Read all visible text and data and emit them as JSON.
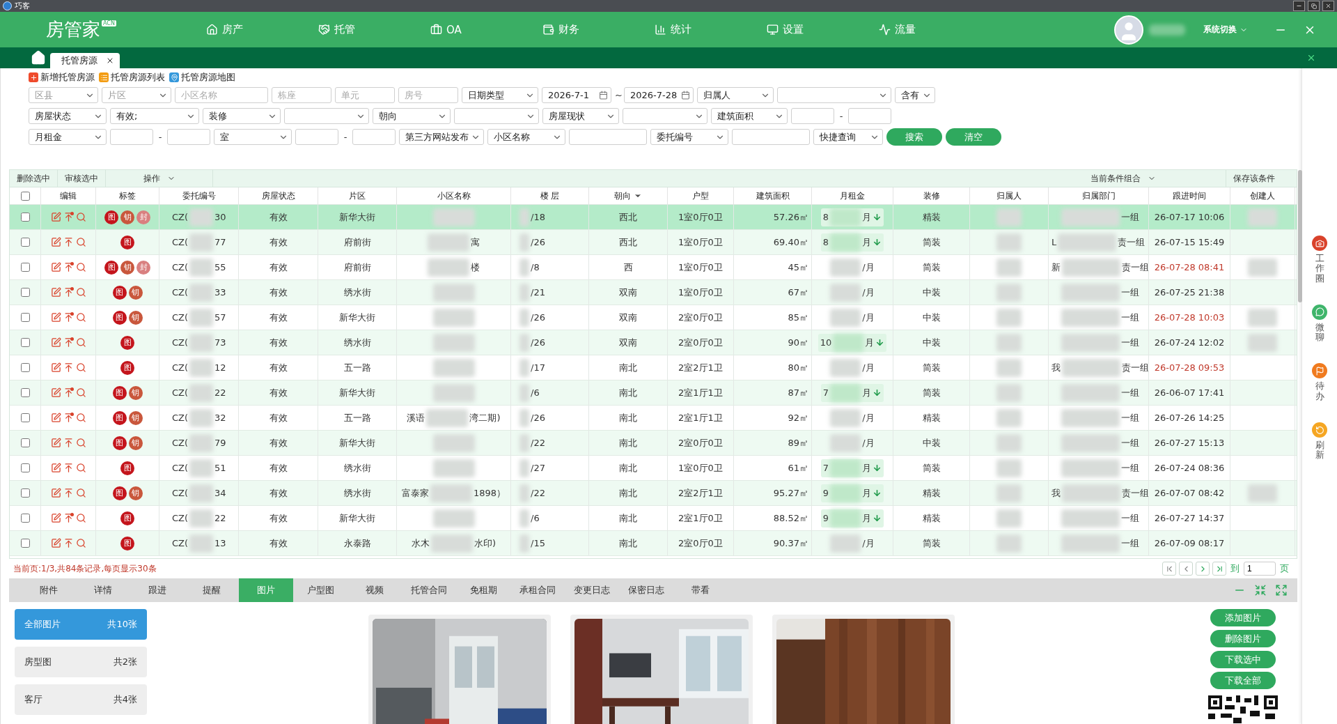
{
  "app": {
    "title": "巧客"
  },
  "header": {
    "logo": "房管家",
    "logo_badge": "ACN",
    "nav": [
      {
        "label": "房产"
      },
      {
        "label": "托管"
      },
      {
        "label": "OA"
      },
      {
        "label": "财务"
      },
      {
        "label": "统计"
      },
      {
        "label": "设置"
      },
      {
        "label": "流量"
      }
    ],
    "system_switch": "系统切换"
  },
  "tabs": [
    {
      "label": "托管房源",
      "selected": true
    }
  ],
  "links": [
    {
      "label": "新增托管房源"
    },
    {
      "label": "托管房源列表"
    },
    {
      "label": "托管房源地图"
    }
  ],
  "filters": [
    [
      {
        "kind": "select",
        "placeholder": "区县"
      },
      {
        "kind": "select",
        "placeholder": "片区"
      },
      {
        "kind": "input",
        "placeholder": "小区名称"
      },
      {
        "kind": "input",
        "placeholder": "栋座"
      },
      {
        "kind": "input",
        "placeholder": "单元"
      },
      {
        "kind": "input",
        "placeholder": "房号"
      },
      {
        "kind": "select",
        "value": "日期类型"
      },
      {
        "kind": "date",
        "value": "2026-7-1"
      },
      {
        "kind": "sep",
        "text": "~"
      },
      {
        "kind": "date",
        "value": "2026-7-28"
      },
      {
        "kind": "select",
        "value": "归属人"
      },
      {
        "kind": "select"
      },
      {
        "kind": "select",
        "value": "含有"
      }
    ],
    [
      {
        "kind": "select",
        "value": "房屋状态"
      },
      {
        "kind": "select",
        "value": "有效;"
      },
      {
        "kind": "select",
        "value": "装修"
      },
      {
        "kind": "select"
      },
      {
        "kind": "select",
        "value": "朝向"
      },
      {
        "kind": "select"
      },
      {
        "kind": "select",
        "value": "房屋现状"
      },
      {
        "kind": "select"
      },
      {
        "kind": "select",
        "value": "建筑面积"
      },
      {
        "kind": "input"
      },
      {
        "kind": "sep",
        "text": "-"
      },
      {
        "kind": "input"
      }
    ],
    [
      {
        "kind": "select",
        "value": "月租金"
      },
      {
        "kind": "input"
      },
      {
        "kind": "sep",
        "text": "-"
      },
      {
        "kind": "input"
      },
      {
        "kind": "select",
        "value": "室"
      },
      {
        "kind": "input"
      },
      {
        "kind": "sep",
        "text": "-"
      },
      {
        "kind": "input"
      },
      {
        "kind": "select",
        "value": "第三方网站发布"
      },
      {
        "kind": "select",
        "value": "小区名称"
      },
      {
        "kind": "input"
      },
      {
        "kind": "select",
        "value": "委托编号"
      },
      {
        "kind": "input"
      },
      {
        "kind": "select",
        "value": "快捷查询"
      },
      {
        "kind": "button",
        "label": "搜索"
      },
      {
        "kind": "button",
        "label": "清空"
      }
    ]
  ],
  "toolbar": {
    "actions": [
      "删除选中",
      "审核选中"
    ],
    "menu": "操作",
    "combo": "当前条件组合",
    "save": "保存该条件"
  },
  "table": {
    "all_checked": false,
    "columns": [
      {
        "label": "编辑",
        "sorted": false
      },
      {
        "label": "标签",
        "sorted": false
      },
      {
        "label": "委托编号",
        "sorted": false
      },
      {
        "label": "房屋状态",
        "sorted": false
      },
      {
        "label": "片区",
        "sorted": false
      },
      {
        "label": "小区名称",
        "sorted": false
      },
      {
        "label": "楼 层",
        "sorted": false
      },
      {
        "label": "朝向",
        "sorted": true
      },
      {
        "label": "户型",
        "sorted": false
      },
      {
        "label": "建筑面积",
        "sorted": false
      },
      {
        "label": "月租金",
        "sorted": false
      },
      {
        "label": "装修",
        "sorted": false
      },
      {
        "label": "归属人",
        "sorted": false
      },
      {
        "label": "归属部门",
        "sorted": false
      },
      {
        "label": "跟进时间",
        "sorted": false
      },
      {
        "label": "创建人",
        "sorted": false
      }
    ],
    "rows": [
      {
        "selected": true,
        "checked": false,
        "pin_dot": true,
        "tags": [
          "图",
          "钥",
          "封"
        ],
        "code": [
          "CZ(",
          "30"
        ],
        "status": "有效",
        "area": "新华大街",
        "floor": "/18",
        "orient": "西北",
        "layout": "1室0厅0卫",
        "size": "57.26㎡",
        "rent": {
          "prefix": "8",
          "unit": "月",
          "down": true
        },
        "decor": "精装",
        "dept": {
          "after": "一组"
        },
        "time": "26-07-17 10:06",
        "recent": false,
        "creator_hidden": true
      },
      {
        "selected": false,
        "checked": false,
        "pin_dot": false,
        "tags": [
          "图"
        ],
        "code": [
          "CZ(",
          "77"
        ],
        "status": "有效",
        "area": "府前街",
        "community": {
          "after": "寓"
        },
        "floor": "/26",
        "orient": "西北",
        "layout": "1室0厅0卫",
        "size": "69.40㎡",
        "rent": {
          "prefix": "8",
          "unit": "月",
          "down": true
        },
        "decor": "简装",
        "dept": {
          "before": "L",
          "after": "责一组"
        },
        "time": "26-07-15 15:49",
        "recent": false,
        "creator_hidden": false
      },
      {
        "selected": false,
        "checked": false,
        "pin_dot": true,
        "tags": [
          "图",
          "钥",
          "封"
        ],
        "code": [
          "CZ(",
          "55"
        ],
        "status": "有效",
        "area": "府前街",
        "community": {
          "after": "楼"
        },
        "floor": "/8",
        "orient": "西",
        "layout": "1室0厅0卫",
        "size": "45㎡",
        "rent": {
          "unit": "/月",
          "down": false
        },
        "decor": "简装",
        "dept": {
          "before": "新",
          "after": "责一组"
        },
        "time": "26-07-28 08:41",
        "recent": true,
        "creator_hidden": true
      },
      {
        "selected": false,
        "checked": false,
        "pin_dot": true,
        "tags": [
          "图",
          "钥"
        ],
        "code": [
          "CZ(",
          "33"
        ],
        "status": "有效",
        "area": "绣水街",
        "floor": "/21",
        "orient": "双南",
        "layout": "1室0厅0卫",
        "size": "67㎡",
        "rent": {
          "unit": "/月",
          "down": false
        },
        "decor": "中装",
        "dept": {
          "after": "一组"
        },
        "time": "26-07-25 21:38",
        "recent": false,
        "creator_hidden": false
      },
      {
        "selected": false,
        "checked": false,
        "pin_dot": true,
        "tags": [
          "图",
          "钥"
        ],
        "code": [
          "CZ(",
          "57"
        ],
        "status": "有效",
        "area": "新华大街",
        "floor": "/26",
        "orient": "双南",
        "layout": "2室0厅0卫",
        "size": "85㎡",
        "rent": {
          "unit": "/月",
          "down": false
        },
        "decor": "中装",
        "dept": {
          "after": "一组"
        },
        "time": "26-07-28 10:03",
        "recent": true,
        "creator_hidden": true
      },
      {
        "selected": false,
        "checked": false,
        "pin_dot": true,
        "tags": [
          "图"
        ],
        "code": [
          "CZ(",
          "73"
        ],
        "status": "有效",
        "area": "绣水街",
        "floor": "/26",
        "orient": "双南",
        "layout": "2室0厅0卫",
        "size": "90㎡",
        "rent": {
          "prefix": "10",
          "unit": "月",
          "down": true
        },
        "decor": "中装",
        "dept": {
          "after": "一组"
        },
        "time": "26-07-24 12:02",
        "recent": false,
        "creator_hidden": true
      },
      {
        "selected": false,
        "checked": false,
        "pin_dot": false,
        "tags": [
          "图"
        ],
        "code": [
          "CZ(",
          "12"
        ],
        "status": "有效",
        "area": "五一路",
        "floor": "/17",
        "orient": "南北",
        "layout": "2室2厅1卫",
        "size": "80㎡",
        "rent": {
          "unit": "/月",
          "down": false
        },
        "decor": "简装",
        "dept": {
          "before": "我",
          "after": "责一组"
        },
        "time": "26-07-28 09:53",
        "recent": true,
        "creator_hidden": false
      },
      {
        "selected": false,
        "checked": false,
        "pin_dot": true,
        "tags": [
          "图",
          "钥"
        ],
        "code": [
          "CZ(",
          "22"
        ],
        "status": "有效",
        "area": "新华大街",
        "floor": "/6",
        "orient": "南北",
        "layout": "2室1厅1卫",
        "size": "87㎡",
        "rent": {
          "prefix": "7",
          "unit": "月",
          "down": true
        },
        "decor": "简装",
        "dept": {
          "after": "一组"
        },
        "time": "26-06-07 17:41",
        "recent": false,
        "creator_hidden": false
      },
      {
        "selected": false,
        "checked": false,
        "pin_dot": true,
        "tags": [
          "图",
          "钥"
        ],
        "code": [
          "CZ(",
          "32"
        ],
        "status": "有效",
        "area": "五一路",
        "community": {
          "before": "溪语",
          "after": "湾二期)"
        },
        "floor": "/26",
        "orient": "南北",
        "layout": "2室1厅1卫",
        "size": "92㎡",
        "rent": {
          "unit": "/月",
          "down": false
        },
        "decor": "精装",
        "dept": {
          "after": "一组"
        },
        "time": "26-07-26 14:25",
        "recent": false,
        "creator_hidden": false
      },
      {
        "selected": false,
        "checked": false,
        "pin_dot": false,
        "tags": [
          "图",
          "钥"
        ],
        "code": [
          "CZ(",
          "79"
        ],
        "status": "有效",
        "area": "新华大街",
        "floor": "/22",
        "orient": "南北",
        "layout": "2室0厅0卫",
        "size": "89㎡",
        "rent": {
          "unit": "/月",
          "down": false
        },
        "decor": "中装",
        "dept": {
          "after": "一组"
        },
        "time": "26-07-27 15:13",
        "recent": false,
        "creator_hidden": false
      },
      {
        "selected": false,
        "checked": false,
        "pin_dot": false,
        "tags": [
          "图"
        ],
        "code": [
          "CZ(",
          "51"
        ],
        "status": "有效",
        "area": "绣水街",
        "floor": "/27",
        "orient": "南北",
        "layout": "1室0厅0卫",
        "size": "61㎡",
        "rent": {
          "prefix": "7",
          "unit": "月",
          "down": true
        },
        "decor": "简装",
        "dept": {
          "after": "一组"
        },
        "time": "26-07-24 08:36",
        "recent": false,
        "creator_hidden": false
      },
      {
        "selected": false,
        "checked": false,
        "pin_dot": false,
        "tags": [
          "图",
          "钥"
        ],
        "code": [
          "CZ(",
          "34"
        ],
        "status": "有效",
        "area": "绣水街",
        "community": {
          "before": "富泰家",
          "after": "1898）"
        },
        "floor": "/22",
        "orient": "南北",
        "layout": "2室2厅1卫",
        "size": "95.27㎡",
        "rent": {
          "prefix": "9",
          "unit": "月",
          "down": true
        },
        "decor": "精装",
        "dept": {
          "before": "我",
          "after": "责一组"
        },
        "time": "26-07-07 08:42",
        "recent": false,
        "creator_hidden": true
      },
      {
        "selected": false,
        "checked": false,
        "pin_dot": true,
        "tags": [
          "图"
        ],
        "code": [
          "CZ(",
          "22"
        ],
        "status": "有效",
        "area": "新华大街",
        "floor": "/6",
        "orient": "南北",
        "layout": "2室1厅0卫",
        "size": "88.52㎡",
        "rent": {
          "prefix": "9",
          "unit": "月",
          "down": true
        },
        "decor": "精装",
        "dept": {
          "after": "一组"
        },
        "time": "26-07-27 14:37",
        "recent": false,
        "creator_hidden": false
      },
      {
        "selected": false,
        "checked": false,
        "pin_dot": false,
        "tags": [
          "图"
        ],
        "code": [
          "CZ(",
          "13"
        ],
        "status": "有效",
        "area": "永泰路",
        "community": {
          "before": "水木",
          "after": "水印)"
        },
        "floor": "/15",
        "orient": "南北",
        "layout": "2室0厅0卫",
        "size": "90.37㎡",
        "rent": {
          "unit": "/月",
          "down": false
        },
        "decor": "简装",
        "dept": {
          "after": "一组"
        },
        "time": "26-07-09 08:17",
        "recent": false,
        "creator_hidden": false
      }
    ]
  },
  "status": "当前页:1/3,共84条记录,每页显示30条",
  "pager": {
    "goto": "到",
    "page": "1",
    "unit": "页"
  },
  "detail_tabs": [
    {
      "label": "附件",
      "selected": false
    },
    {
      "label": "详情",
      "selected": false
    },
    {
      "label": "跟进",
      "selected": false
    },
    {
      "label": "提醒",
      "selected": false
    },
    {
      "label": "图片",
      "selected": true
    },
    {
      "label": "户型图",
      "selected": false
    },
    {
      "label": "视频",
      "selected": false
    },
    {
      "label": "托管合同",
      "selected": false
    },
    {
      "label": "免租期",
      "selected": false
    },
    {
      "label": "承租合同",
      "selected": false
    },
    {
      "label": "变更日志",
      "selected": false
    },
    {
      "label": "保密日志",
      "selected": false
    },
    {
      "label": "带看",
      "selected": false
    }
  ],
  "categories": [
    {
      "label": "全部图片",
      "count": "共10张",
      "selected": true
    },
    {
      "label": "房型图",
      "count": "共2张",
      "selected": false
    },
    {
      "label": "客厅",
      "count": "共4张",
      "selected": false
    }
  ],
  "photos": [
    {
      "kind": "picture"
    },
    {
      "kind": "picture"
    },
    {
      "kind": "picture"
    }
  ],
  "actions": [
    "添加图片",
    "删除图片",
    "下载选中",
    "下载全部"
  ],
  "side": [
    {
      "label": "工作圈"
    },
    {
      "label": "微聊"
    },
    {
      "label": "待办"
    },
    {
      "label": "刷新"
    }
  ]
}
